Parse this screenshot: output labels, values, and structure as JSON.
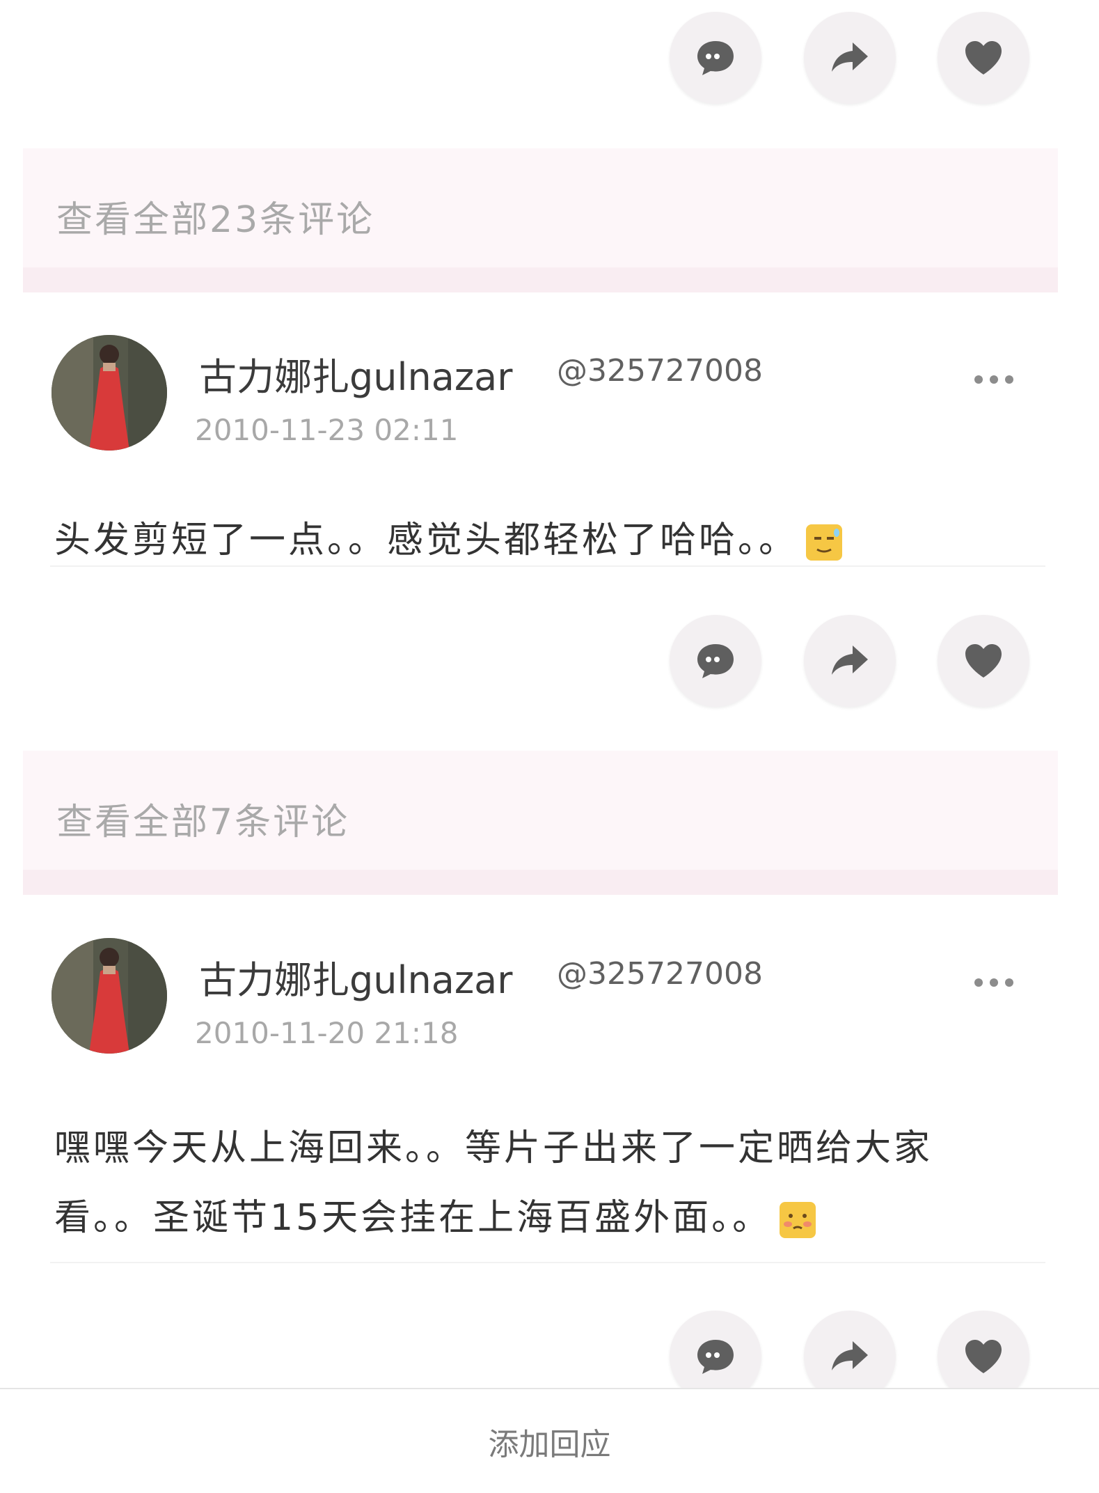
{
  "actions": {
    "comment_icon": "comment-bubble-icon",
    "share_icon": "share-arrow-icon",
    "like_icon": "heart-icon",
    "icon_color": "#5f5f5f"
  },
  "comment_links": [
    "查看全部23条评论",
    "查看全部7条评论"
  ],
  "posts": [
    {
      "author": "古力娜扎gulnazar",
      "handle": "@325727008",
      "time": "2010-11-23 02:11",
      "text_lines": [
        "头发剪短了一点。。感觉头都轻松了哈哈。。"
      ],
      "emoji": "sweat-smile-emoji-icon"
    },
    {
      "author": "古力娜扎gulnazar",
      "handle": "@325727008",
      "time": "2010-11-20 21:18",
      "text_lines": [
        "嘿嘿今天从上海回来。。等片子出来了一定晒给大家",
        "看。。圣诞节15天会挂在上海百盛外面。。"
      ],
      "emoji": "shy-emoji-icon"
    }
  ],
  "footer": {
    "add_reply": "添加回应"
  }
}
